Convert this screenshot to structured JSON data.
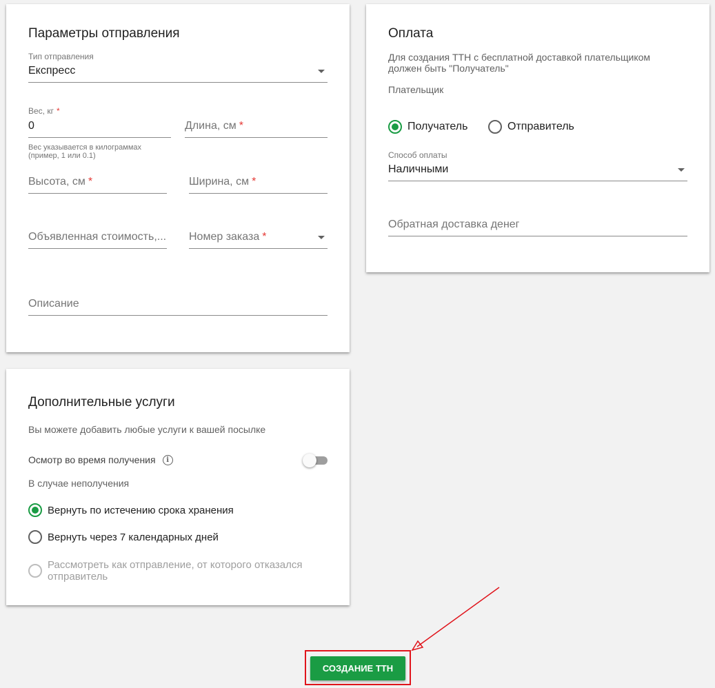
{
  "shipment": {
    "title": "Параметры отправления",
    "type_label": "Тип отправления",
    "type_value": "Експресс",
    "weight_label": "Вес, кг",
    "weight_required": "*",
    "weight_value": "0",
    "weight_hint": "Вес указывается в килограммах (пример, 1 или 0.1)",
    "length_placeholder": "Длина, см",
    "height_placeholder": "Высота, см",
    "width_placeholder": "Ширина, см",
    "declared_value_placeholder": "Объявленная стоимость,...",
    "order_number_placeholder": "Номер заказа",
    "description_placeholder": "Описание",
    "required_mark": "*"
  },
  "payment": {
    "title": "Оплата",
    "notice": "Для создания ТТН с бесплатной доставкой плательщиком должен быть \"Получатель\"",
    "payer_label": "Плательщик",
    "payer_options": [
      "Получатель",
      "Отправитель"
    ],
    "payer_selected": "Получатель",
    "method_label": "Способ оплаты",
    "method_value": "Наличными",
    "cod_placeholder": "Обратная доставка денег"
  },
  "services": {
    "title": "Дополнительные услуги",
    "subtitle": "Вы можете добавить любые услуги к вашей посылке",
    "inspection_label": "Осмотр во время получения",
    "inspection_enabled": false,
    "non_receipt_label": "В случае неполучения",
    "non_receipt_options": [
      "Вернуть по истечению срока хранения",
      "Вернуть через 7 календарных дней",
      "Рассмотреть как отправление, от которого отказался отправитель"
    ],
    "non_receipt_selected": "Вернуть по истечению срока хранения"
  },
  "actions": {
    "create_label": "СОЗДАНИЕ ТТН"
  },
  "colors": {
    "accent": "#1a9c44",
    "required": "#e53935",
    "annotation": "#e0141b"
  }
}
